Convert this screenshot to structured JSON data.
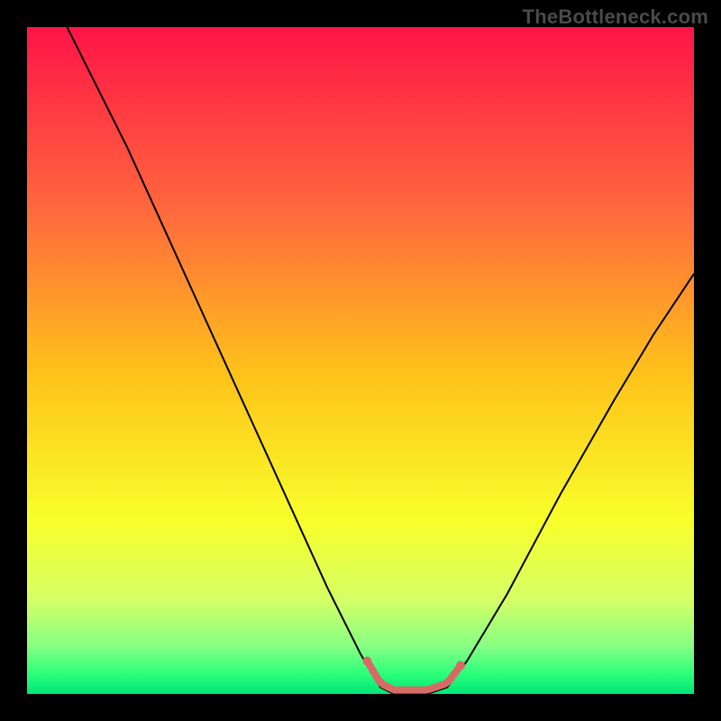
{
  "watermark": "TheBottleneck.com",
  "colors": {
    "black": "#000000",
    "curve": "#000000",
    "marker": "#d86a66",
    "gradient_stops": [
      {
        "offset": 0.0,
        "color": "#ff1447"
      },
      {
        "offset": 0.28,
        "color": "#ff6a3d"
      },
      {
        "offset": 0.52,
        "color": "#ffc21a"
      },
      {
        "offset": 0.74,
        "color": "#f8ff2a"
      },
      {
        "offset": 0.86,
        "color": "#d4ff66"
      },
      {
        "offset": 0.93,
        "color": "#84ff84"
      },
      {
        "offset": 0.97,
        "color": "#2bff7a"
      },
      {
        "offset": 1.0,
        "color": "#00e676"
      }
    ]
  },
  "chart_data": {
    "type": "line",
    "title": "",
    "xlabel": "",
    "ylabel": "",
    "x_range": [
      0,
      100
    ],
    "y_range": [
      0,
      100
    ],
    "curve": [
      {
        "x": 6,
        "y": 100
      },
      {
        "x": 10,
        "y": 92
      },
      {
        "x": 15,
        "y": 82
      },
      {
        "x": 20,
        "y": 71
      },
      {
        "x": 25,
        "y": 60
      },
      {
        "x": 30,
        "y": 49
      },
      {
        "x": 35,
        "y": 38
      },
      {
        "x": 40,
        "y": 27
      },
      {
        "x": 45,
        "y": 16
      },
      {
        "x": 50,
        "y": 6
      },
      {
        "x": 53,
        "y": 1
      },
      {
        "x": 55,
        "y": 0
      },
      {
        "x": 60,
        "y": 0
      },
      {
        "x": 63,
        "y": 1
      },
      {
        "x": 66,
        "y": 5
      },
      {
        "x": 72,
        "y": 15
      },
      {
        "x": 80,
        "y": 30
      },
      {
        "x": 88,
        "y": 44
      },
      {
        "x": 94,
        "y": 54
      },
      {
        "x": 100,
        "y": 63
      }
    ],
    "optimal_zone": {
      "x_start": 51,
      "x_end": 65,
      "y": 0
    },
    "interpretation": "V-shaped bottleneck curve; minimum (near-zero bottleneck) occurs around x 55–62; left branch rises steeply to 100, right branch rises to about 63."
  }
}
